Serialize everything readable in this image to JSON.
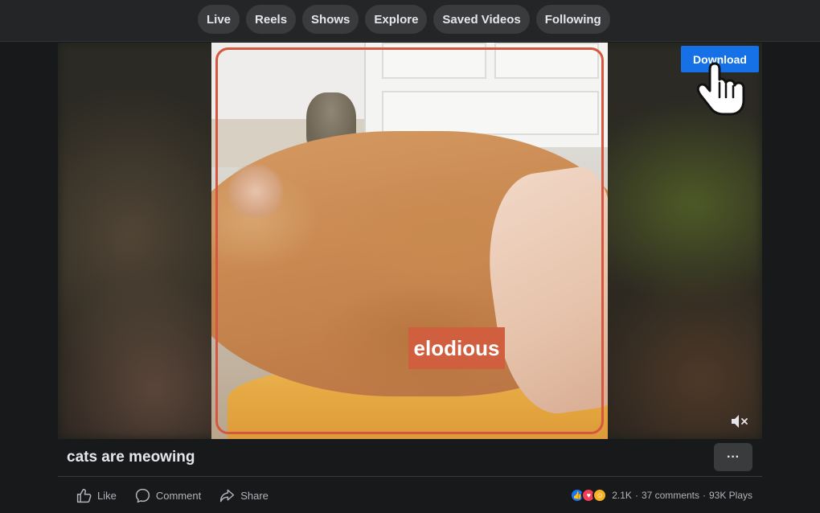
{
  "nav": {
    "tabs": [
      {
        "label": "Live"
      },
      {
        "label": "Reels"
      },
      {
        "label": "Shows"
      },
      {
        "label": "Explore"
      },
      {
        "label": "Saved Videos"
      },
      {
        "label": "Following"
      }
    ]
  },
  "video": {
    "caption_text": "elodious",
    "download_label": "Download"
  },
  "post": {
    "title": "cats are meowing",
    "more_label": "···",
    "actions": {
      "like": "Like",
      "comment": "Comment",
      "share": "Share"
    },
    "stats": {
      "reactions_count": "2.1K",
      "separator": "·",
      "comments": "37 comments",
      "plays": "93K Plays"
    }
  },
  "colors": {
    "accent": "#1771e6",
    "highlight_border": "#d4573f",
    "caption_bg": "#cf5f3f"
  }
}
